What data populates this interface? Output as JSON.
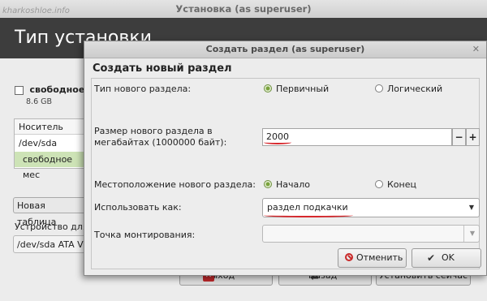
{
  "watermark": "kharkoshloe.info",
  "window": {
    "title": "Установка (as superuser)"
  },
  "page": {
    "heading": "Тип установки"
  },
  "free_space": {
    "label": "свободное м",
    "size": "8.6 GB"
  },
  "partition_table": {
    "header": "Носитель",
    "rows": [
      "/dev/sda",
      "свободное мес"
    ]
  },
  "buttons": {
    "new_table": "Новая таблица",
    "quit": "Выход",
    "back": "Назад",
    "install": "Установить сейчас"
  },
  "device": {
    "label": "Устройство для",
    "value": "/dev/sda   ATA V"
  },
  "dialog": {
    "title": "Создать раздел (as superuser)",
    "heading": "Создать новый раздел",
    "type_label": "Тип нового раздела:",
    "type_options": {
      "primary": "Первичный",
      "logical": "Логический",
      "selected": "primary"
    },
    "size_label": "Размер нового раздела в мегабайтах (1000000 байт):",
    "size_value": "2000",
    "location_label": "Местоположение нового раздела:",
    "location_options": {
      "begin": "Начало",
      "end": "Конец",
      "selected": "begin"
    },
    "use_label": "Использовать как:",
    "use_value": "раздел подкачки",
    "mount_label": "Точка монтирования:",
    "mount_value": "",
    "cancel": "Отменить",
    "ok": "OK"
  },
  "colors": {
    "header_bg": "#3d3d3d",
    "selected_row": "#cde3b6",
    "annotation": "#d7282d"
  }
}
